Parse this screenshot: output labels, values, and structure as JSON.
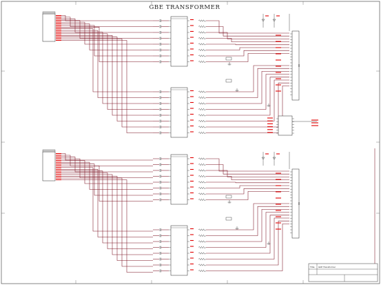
{
  "sheet": {
    "title": "GBE TRANSFORMER",
    "title_block": {
      "name_label": "Title",
      "name_value": "GbE Transformer"
    }
  },
  "colors": {
    "wire": "#7a1020",
    "net_label": "#e00000",
    "component": "#222222",
    "border": "#333333"
  }
}
